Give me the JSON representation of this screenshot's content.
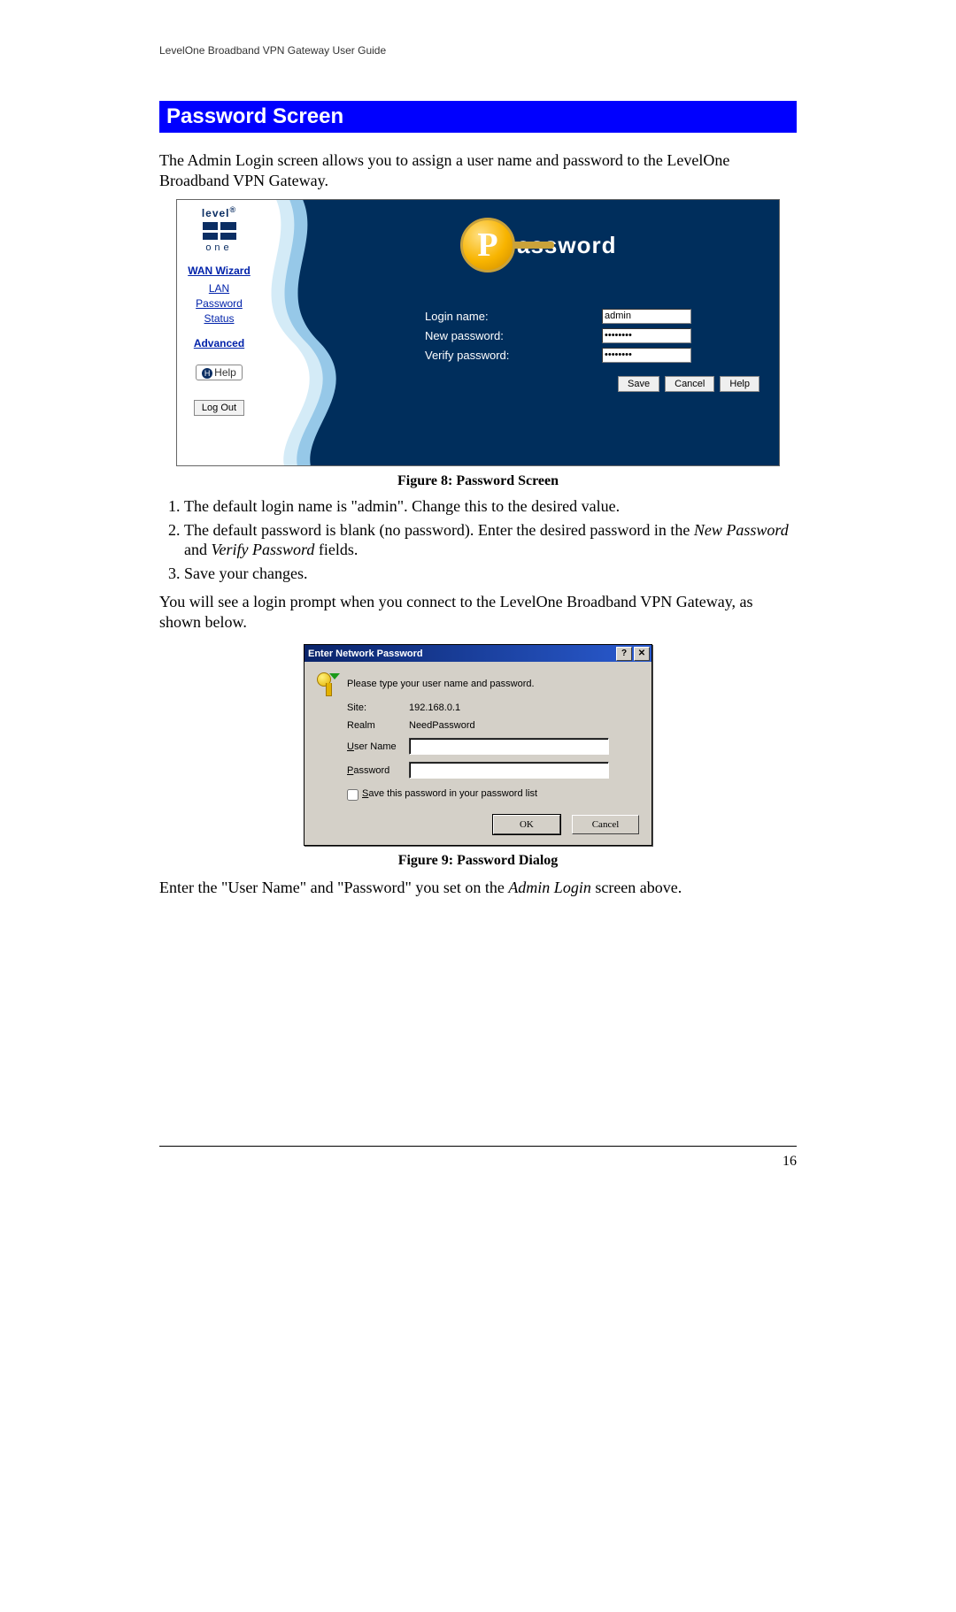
{
  "header": {
    "running": "LevelOne Broadband VPN Gateway User Guide"
  },
  "section": {
    "title": "Password Screen"
  },
  "intro": "The Admin Login screen allows you to assign a user name and password to the LevelOne Broadband VPN Gateway.",
  "fig8": {
    "caption": "Figure 8: Password Screen",
    "logo": {
      "brand_top": "level",
      "sup": "®",
      "brand_bottom": "one"
    },
    "nav": {
      "wizard": "WAN Wizard",
      "lan": "LAN",
      "password": "Password",
      "status": "Status",
      "advanced": "Advanced",
      "help": "Help",
      "logout": "Log Out"
    },
    "title_word_suffix": "assword",
    "labels": {
      "login": "Login name:",
      "newpw": "New password:",
      "verify": "Verify password:"
    },
    "values": {
      "login": "admin",
      "newpw": "••••••••",
      "verify": "••••••••"
    },
    "buttons": {
      "save": "Save",
      "cancel": "Cancel",
      "help": "Help"
    }
  },
  "steps": {
    "s1": "The default login name is \"admin\". Change this to the desired value.",
    "s2_a": "The default password is blank (no password). Enter the desired password in the ",
    "s2_i1": "New Password",
    "s2_mid": " and ",
    "s2_i2": "Verify Password",
    "s2_b": " fields.",
    "s3": "Save your changes."
  },
  "after_steps": "You will see a login prompt when you connect to the LevelOne Broadband VPN Gateway, as shown below.",
  "fig9": {
    "caption": "Figure 9: Password Dialog",
    "title": "Enter Network Password",
    "prompt": "Please type your user name and password.",
    "labels": {
      "site": "Site:",
      "realm": "Realm",
      "user_pre": "U",
      "user_mid": "ser Name",
      "pass_pre": "P",
      "pass_mid": "assword",
      "save_pre": "S",
      "save_mid": "ave this password in your password list"
    },
    "values": {
      "site": "192.168.0.1",
      "realm": "NeedPassword"
    },
    "buttons": {
      "ok": "OK",
      "cancel": "Cancel"
    }
  },
  "closing_a": "Enter the \"User Name\" and \"Password\" you set on the ",
  "closing_i": "Admin Login",
  "closing_b": " screen above.",
  "page_number": "16"
}
